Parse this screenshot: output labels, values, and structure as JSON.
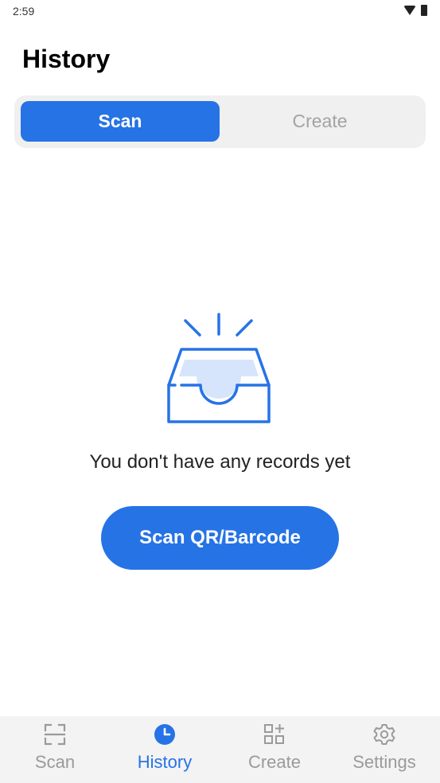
{
  "status_bar": {
    "time": "2:59"
  },
  "header": {
    "title": "History"
  },
  "segment": {
    "scan_label": "Scan",
    "create_label": "Create",
    "selected": "Scan"
  },
  "empty_state": {
    "message": "You don't have any records yet",
    "button_label": "Scan QR/Barcode"
  },
  "bottom_nav": {
    "items": [
      {
        "label": "Scan",
        "icon": "scan-frame-icon",
        "active": false
      },
      {
        "label": "History",
        "icon": "clock-icon",
        "active": true
      },
      {
        "label": "Create",
        "icon": "grid-plus-icon",
        "active": false
      },
      {
        "label": "Settings",
        "icon": "gear-icon",
        "active": false
      }
    ]
  },
  "colors": {
    "accent": "#2673e6",
    "inactive": "#9a9a9a",
    "segment_bg": "#f0f0f0",
    "nav_bg": "#f3f3f3"
  }
}
